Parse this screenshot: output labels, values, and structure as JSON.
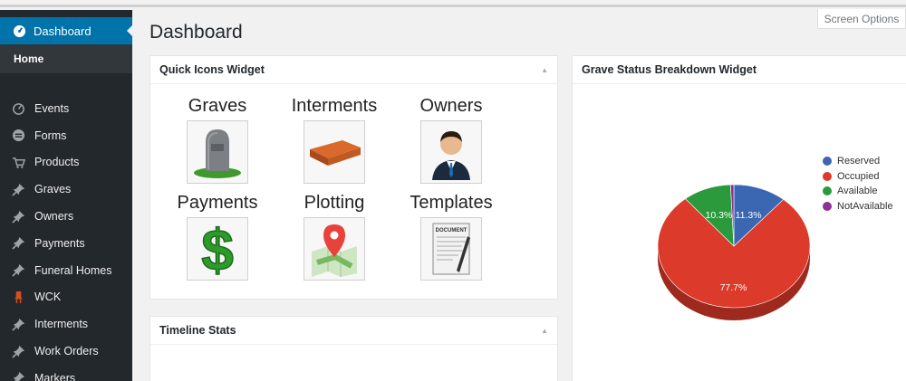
{
  "sidebar": {
    "active": {
      "label": "Dashboard",
      "icon": "dashboard-icon"
    },
    "home": "Home",
    "items": [
      {
        "label": "Events",
        "icon": "timer-icon"
      },
      {
        "label": "Forms",
        "icon": "forms-icon"
      },
      {
        "label": "Products",
        "icon": "cart-icon"
      },
      {
        "label": "Graves",
        "icon": "pin-icon"
      },
      {
        "label": "Owners",
        "icon": "pin-icon"
      },
      {
        "label": "Payments",
        "icon": "pin-icon"
      },
      {
        "label": "Funeral Homes",
        "icon": "pin-icon"
      },
      {
        "label": "WCK",
        "icon": "chair-icon"
      },
      {
        "label": "Interments",
        "icon": "pin-icon"
      },
      {
        "label": "Work Orders",
        "icon": "pin-icon"
      },
      {
        "label": "Markers",
        "icon": "pin-icon"
      }
    ]
  },
  "header": {
    "title": "Dashboard",
    "screen_options": "Screen Options"
  },
  "quick_icons": {
    "title": "Quick Icons Widget",
    "items": [
      {
        "label": "Graves",
        "icon": "gravestone-icon"
      },
      {
        "label": "Interments",
        "icon": "coffin-icon"
      },
      {
        "label": "Owners",
        "icon": "person-icon"
      },
      {
        "label": "Payments",
        "icon": "dollar-icon"
      },
      {
        "label": "Plotting",
        "icon": "map-pin-icon"
      },
      {
        "label": "Templates",
        "icon": "document-icon"
      }
    ],
    "document_text": "DOCUMENT"
  },
  "timeline": {
    "title": "Timeline Stats"
  },
  "grave_status": {
    "title": "Grave Status Breakdown Widget"
  },
  "chart_data": {
    "type": "pie",
    "series": [
      {
        "name": "Reserved",
        "value": 11.3,
        "label": "11.3%",
        "color": "#3b66b2"
      },
      {
        "name": "Occupied",
        "value": 77.7,
        "label": "77.7%",
        "color": "#dc3a2a"
      },
      {
        "name": "Available",
        "value": 10.3,
        "label": "10.3%",
        "color": "#2a9a3c"
      },
      {
        "name": "NotAvailable",
        "value": 0.7,
        "label": "",
        "color": "#8e3297"
      }
    ],
    "legend_position": "right"
  },
  "colors": {
    "accent": "#0073aa",
    "sidebar_bg": "#23282d"
  }
}
